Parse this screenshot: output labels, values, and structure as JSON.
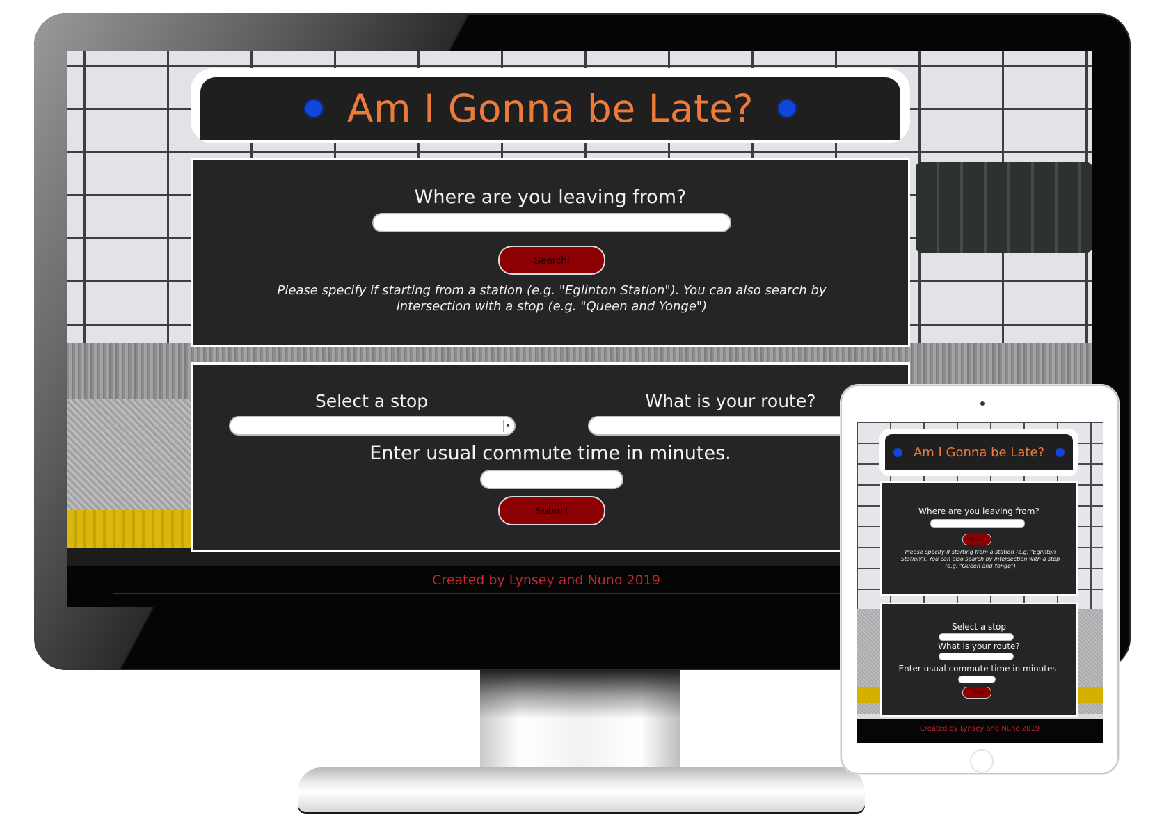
{
  "app": {
    "title": "Am I Gonna be Late?",
    "footer": "Created by Lynsey and Nuno 2019"
  },
  "search_panel": {
    "question": "Where are you leaving from?",
    "input_value": "",
    "search_button": "Search!",
    "hint": "Please specify if starting from a station (e.g. \"Eglinton Station\"). You can also search by intersection with a stop (e.g. \"Queen and Yonge\")"
  },
  "route_panel": {
    "stop_label": "Select a stop",
    "stop_selected": "",
    "route_label": "What is your route?",
    "route_selected": "",
    "commute_label": "Enter usual commute time in minutes.",
    "commute_value": "",
    "submit_button": "Submit"
  },
  "colors": {
    "title_orange": "#ea7b3a",
    "indicator_blue": "#1146d8",
    "panel_bg": "#252526",
    "button_red": "#8c0003",
    "footer_red": "#c1272d"
  }
}
